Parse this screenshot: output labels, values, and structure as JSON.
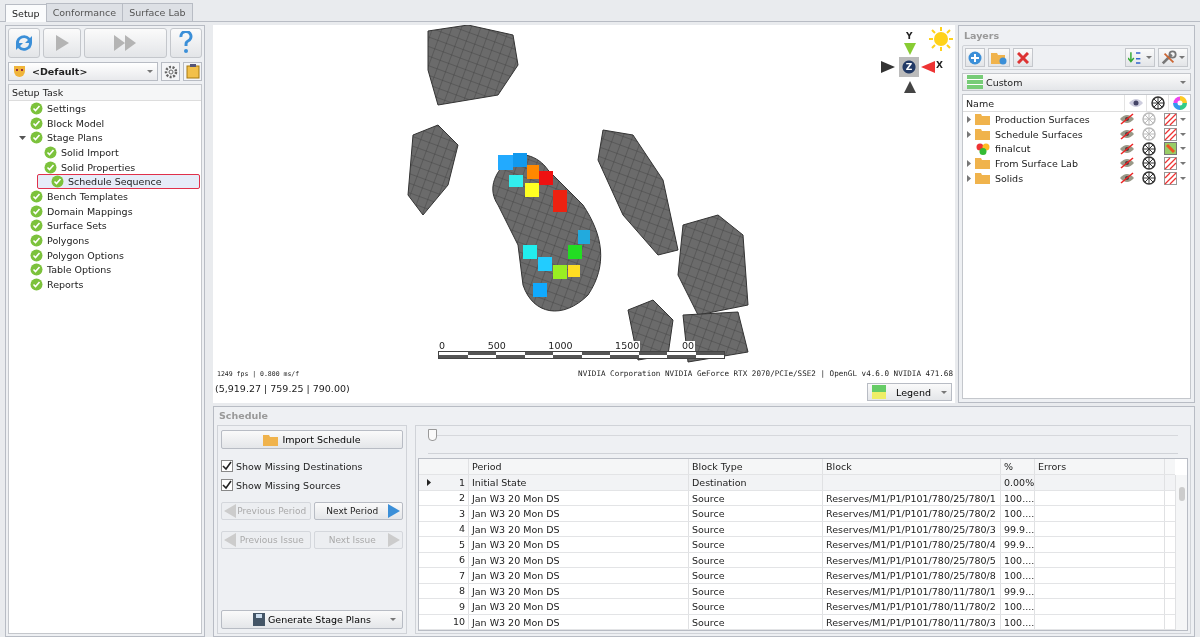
{
  "tabs": [
    {
      "label": "Setup",
      "selected": true
    },
    {
      "label": "Conformance",
      "selected": false
    },
    {
      "label": "Surface Lab",
      "selected": false
    }
  ],
  "toolbar": [
    {
      "kind": "refresh",
      "disabled": false
    },
    {
      "kind": "play",
      "disabled": true
    },
    {
      "kind": "fast-forward",
      "disabled": true
    },
    {
      "kind": "help",
      "disabled": false
    }
  ],
  "profile": {
    "value": "<Default>"
  },
  "tasks": {
    "header": "Setup Task",
    "items": [
      {
        "label": "Settings",
        "complete": true,
        "selected": false
      },
      {
        "label": "Block Model",
        "complete": true,
        "selected": false
      },
      {
        "label": "Stage Plans",
        "complete": true,
        "selected": false,
        "expanded": true,
        "children": [
          {
            "label": "Solid Import",
            "complete": true,
            "selected": false
          },
          {
            "label": "Solid Properties",
            "complete": true,
            "selected": false
          },
          {
            "label": "Schedule Sequence",
            "complete": true,
            "selected": true
          }
        ]
      },
      {
        "label": "Bench Templates",
        "complete": true,
        "selected": false
      },
      {
        "label": "Domain Mappings",
        "complete": true,
        "selected": false
      },
      {
        "label": "Surface Sets",
        "complete": true,
        "selected": false
      },
      {
        "label": "Polygons",
        "complete": true,
        "selected": false
      },
      {
        "label": "Polygon Options",
        "complete": true,
        "selected": false
      },
      {
        "label": "Table Options",
        "complete": true,
        "selected": false
      },
      {
        "label": "Reports",
        "complete": true,
        "selected": false
      }
    ]
  },
  "viewport": {
    "axes": {
      "y": "Y",
      "x": "X",
      "z": "Z"
    },
    "scale_labels": [
      "0",
      "500",
      "1000",
      "1500",
      "00"
    ],
    "fps": "1249 fps | 0.800 ms/f",
    "coordinates": "(5,919.27 | 759.25 | 790.00)",
    "renderer": "NVIDIA Corporation NVIDIA GeForce RTX 2070/PCIe/SSE2 | OpenGL v4.6.0 NVIDIA 471.68",
    "legend_button": "Legend"
  },
  "layers": {
    "title": "Layers",
    "preset": "Custom",
    "name_header": "Name",
    "items": [
      {
        "name": "Production Surfaces",
        "kind": "folder",
        "expandable": true,
        "visible": false,
        "wireframe": false,
        "color_map": false
      },
      {
        "name": "Schedule Surfaces",
        "kind": "folder",
        "expandable": true,
        "visible": false,
        "wireframe": false,
        "color_map": false
      },
      {
        "name": "finalcut",
        "kind": "mesh",
        "expandable": false,
        "visible": false,
        "wireframe": true,
        "color_map": true
      },
      {
        "name": "From Surface Lab",
        "kind": "folder",
        "expandable": true,
        "visible": false,
        "wireframe": true,
        "color_map": false
      },
      {
        "name": "Solids",
        "kind": "folder",
        "expandable": true,
        "visible": false,
        "wireframe": true,
        "color_map": false
      }
    ]
  },
  "schedule": {
    "title": "Schedule",
    "import_button": "Import Schedule",
    "options": [
      {
        "label": "Show Missing Destinations",
        "checked": true
      },
      {
        "label": "Show Missing Sources",
        "checked": true
      }
    ],
    "nav": [
      {
        "label": "Previous Period",
        "kind": "previous",
        "disabled": true
      },
      {
        "label": "Next Period",
        "kind": "next",
        "disabled": false
      },
      {
        "label": "Previous Issue",
        "kind": "previous",
        "disabled": true
      },
      {
        "label": "Next Issue",
        "kind": "next",
        "disabled": true
      }
    ],
    "generate_button": "Generate Stage Plans",
    "slider": {
      "level": 0
    },
    "table": {
      "columns": [
        "Period",
        "Block Type",
        "Block",
        "%",
        "Errors"
      ],
      "rows": [
        {
          "n": "1",
          "selected": true,
          "cells": [
            "Initial State",
            "Destination",
            "",
            "0.00%",
            ""
          ]
        },
        {
          "n": "2",
          "selected": false,
          "cells": [
            "Jan W3 20 Mon DS",
            "Source",
            "Reserves/M1/P1/P101/780/25/780/1",
            "100....",
            ""
          ]
        },
        {
          "n": "3",
          "selected": false,
          "cells": [
            "Jan W3 20 Mon DS",
            "Source",
            "Reserves/M1/P1/P101/780/25/780/2",
            "100....",
            ""
          ]
        },
        {
          "n": "4",
          "selected": false,
          "cells": [
            "Jan W3 20 Mon DS",
            "Source",
            "Reserves/M1/P1/P101/780/25/780/3",
            "99.9...",
            ""
          ]
        },
        {
          "n": "5",
          "selected": false,
          "cells": [
            "Jan W3 20 Mon DS",
            "Source",
            "Reserves/M1/P1/P101/780/25/780/4",
            "99.9...",
            ""
          ]
        },
        {
          "n": "6",
          "selected": false,
          "cells": [
            "Jan W3 20 Mon DS",
            "Source",
            "Reserves/M1/P1/P101/780/25/780/5",
            "100....",
            ""
          ]
        },
        {
          "n": "7",
          "selected": false,
          "cells": [
            "Jan W3 20 Mon DS",
            "Source",
            "Reserves/M1/P1/P101/780/25/780/8",
            "100....",
            ""
          ]
        },
        {
          "n": "8",
          "selected": false,
          "cells": [
            "Jan W3 20 Mon DS",
            "Source",
            "Reserves/M1/P1/P101/780/11/780/1",
            "99.9...",
            ""
          ]
        },
        {
          "n": "9",
          "selected": false,
          "cells": [
            "Jan W3 20 Mon DS",
            "Source",
            "Reserves/M1/P1/P101/780/11/780/2",
            "100....",
            ""
          ]
        },
        {
          "n": "10",
          "selected": false,
          "cells": [
            "Jan W3 20 Mon DS",
            "Source",
            "Reserves/M1/P1/P101/780/11/780/3",
            "100....",
            ""
          ]
        }
      ]
    }
  }
}
